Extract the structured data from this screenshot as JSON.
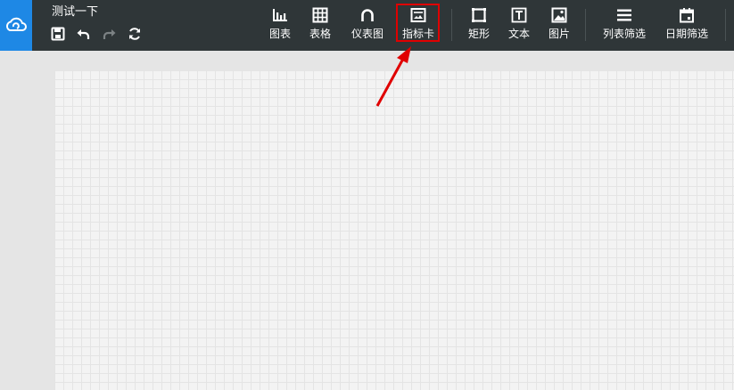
{
  "app": {
    "title": "测试一下",
    "brand_icon": "cloud-logo-icon"
  },
  "quick_actions": [
    {
      "name": "save",
      "icon": "save-icon"
    },
    {
      "name": "undo",
      "icon": "undo-icon"
    },
    {
      "name": "redo",
      "icon": "redo-icon"
    },
    {
      "name": "refresh",
      "icon": "refresh-icon"
    }
  ],
  "toolbar": {
    "chart": "图表",
    "table": "表格",
    "gauge": "仪表图",
    "indicator_card": "指标卡",
    "rectangle": "矩形",
    "text": "文本",
    "image": "图片",
    "list_filter": "列表筛选",
    "date_filter": "日期筛选"
  },
  "colors": {
    "topbar": "#2f3638",
    "brand": "#1e88e5",
    "highlight": "#e00000",
    "canvas": "#f3f3f3",
    "grid": "#e4e4e4"
  }
}
